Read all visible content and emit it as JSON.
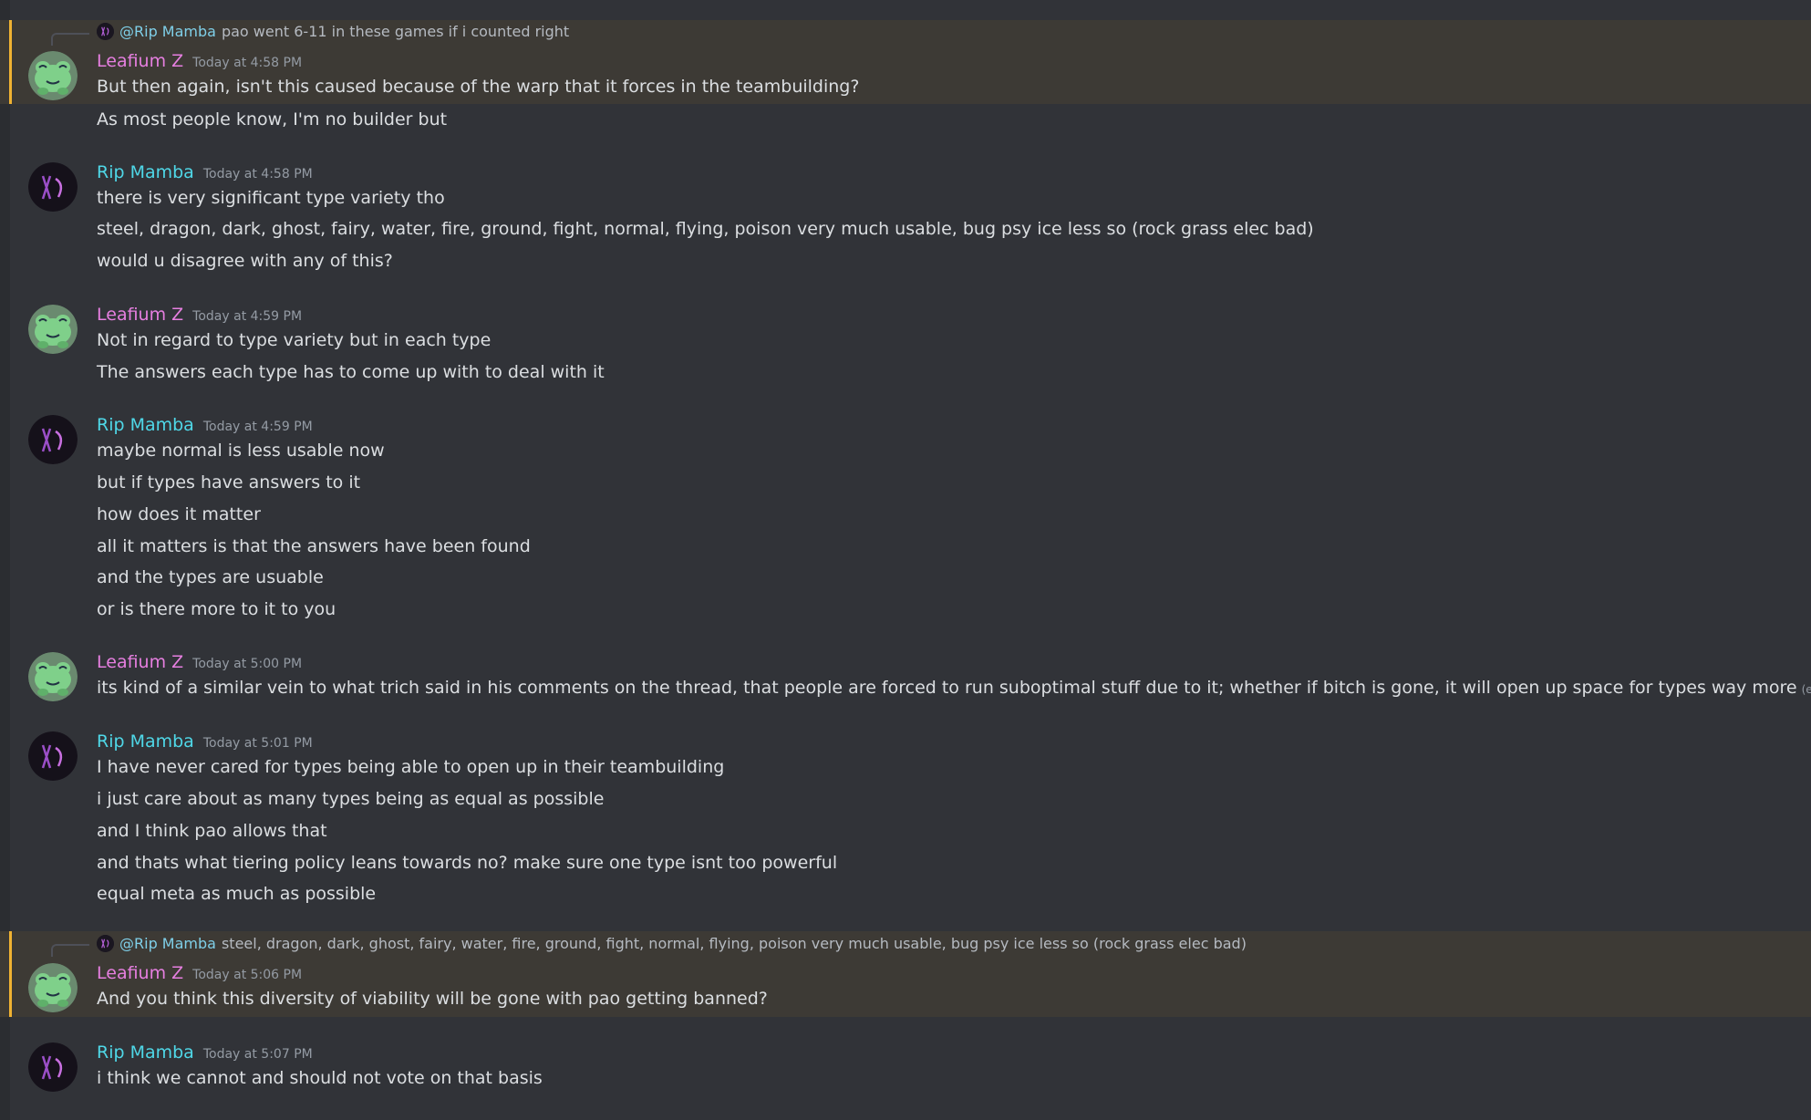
{
  "users": {
    "leafium": "Leafium Z",
    "mamba": "Rip Mamba"
  },
  "colors": {
    "background": "#313338",
    "leafium_name": "#e67fe0",
    "mamba_name": "#4fd8e8",
    "mention_highlight": "#3d3a35",
    "mention_bar": "#f0b232"
  },
  "messages": [
    {
      "reply": {
        "mention": "@Rip Mamba",
        "text": "pao went 6-11 in these games if i counted right"
      },
      "author": "Leafium Z",
      "time": "Today at 4:58 PM",
      "lines": [
        "But then again, isn't this caused because of the warp that it forces in the teambuilding?",
        "As most people know, I'm no builder but"
      ]
    },
    {
      "author": "Rip Mamba",
      "time": "Today at 4:58 PM",
      "lines": [
        "there is very significant type variety tho",
        "steel, dragon, dark, ghost, fairy, water, fire, ground, fight, normal, flying, poison very much usable, bug psy ice less so (rock grass elec bad)",
        "would u disagree with any of this?"
      ]
    },
    {
      "author": "Leafium Z",
      "time": "Today at 4:59 PM",
      "lines": [
        "Not in regard to type variety but in each type",
        "The answers each type has to come up with to deal with it"
      ]
    },
    {
      "author": "Rip Mamba",
      "time": "Today at 4:59 PM",
      "lines": [
        "maybe normal is less usable now",
        "but if types have answers to it",
        "how does it matter",
        "all it matters is that the answers have been found",
        "and the types are usuable",
        "or is there more to it to you"
      ]
    },
    {
      "author": "Leafium Z",
      "time": "Today at 5:00 PM",
      "lines": [
        "its kind of a similar vein to what trich said in his comments on the thread, that people are forced to run suboptimal stuff due to it; whether if bitch is gone, it will open up space for types way more"
      ],
      "edited": "(edited)"
    },
    {
      "author": "Rip Mamba",
      "time": "Today at 5:01 PM",
      "lines": [
        "I have never cared for types being able to open up in their teambuilding",
        "i just care about as many types being as equal as possible",
        "and I think pao allows that",
        "and thats what tiering policy leans towards no? make sure one type isnt too powerful",
        "equal meta as much as possible"
      ]
    },
    {
      "reply": {
        "mention": "@Rip Mamba",
        "text": "steel, dragon, dark, ghost, fairy, water, fire, ground, fight, normal, flying, poison very much usable, bug psy ice less so (rock grass elec bad)"
      },
      "author": "Leafium Z",
      "time": "Today at 5:06 PM",
      "lines": [
        "And you think this diversity of viability will be gone with pao getting banned?"
      ]
    },
    {
      "author": "Rip Mamba",
      "time": "Today at 5:07 PM",
      "lines": [
        "i think we cannot and should not vote on that basis"
      ]
    }
  ]
}
